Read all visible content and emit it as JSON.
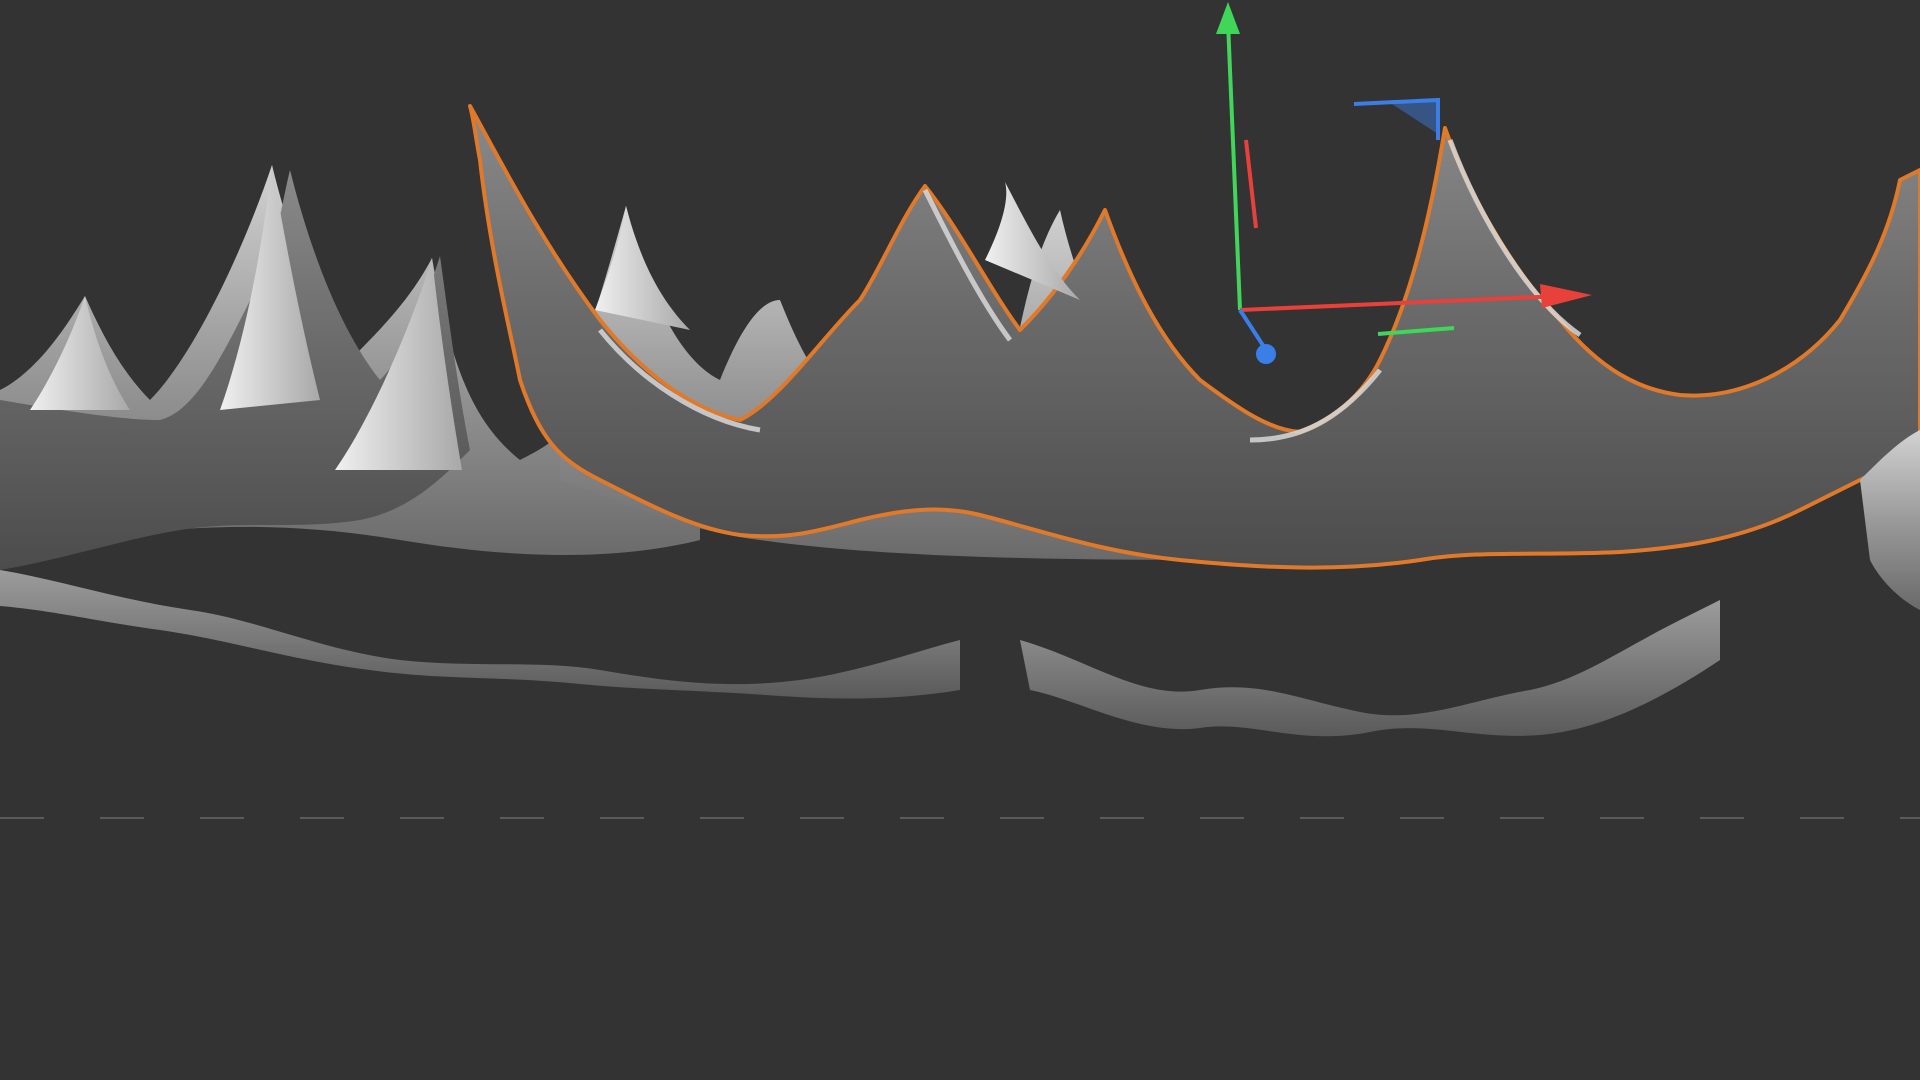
{
  "viewport": {
    "background": "#333333",
    "grid_line_color": "#5a5a5a",
    "grid_visible": true
  },
  "selection": {
    "highlight_color": "#e07a2a",
    "selected_object": "cloth-surface"
  },
  "gizmo": {
    "x_axis_color": "#e8413c",
    "y_axis_color": "#3fd65a",
    "z_axis_color": "#3a7ee8",
    "rotation_indicator_color": "#e8413c"
  },
  "cloth": {
    "base_color": "#6e6e6e",
    "highlight_color": "#d8d8d8",
    "shadow_color": "#4a4a4a"
  }
}
